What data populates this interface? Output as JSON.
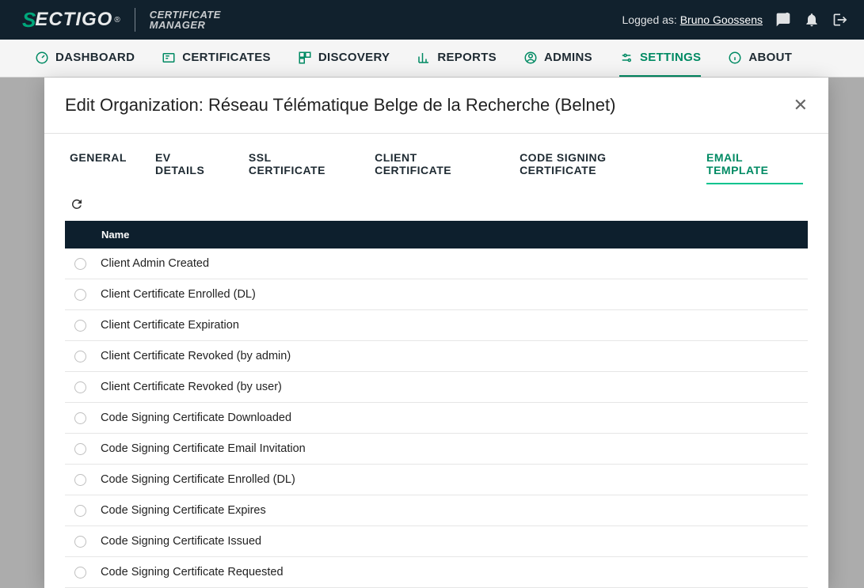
{
  "header": {
    "logo_s": "S",
    "logo_rest": "ECTIGO",
    "logo_reg": "®",
    "logo_sub_line1": "CERTIFICATE",
    "logo_sub_line2": "MANAGER",
    "logged_label": "Logged as:",
    "logged_user": "Bruno Goossens"
  },
  "nav": [
    {
      "label": "DASHBOARD"
    },
    {
      "label": "CERTIFICATES"
    },
    {
      "label": "DISCOVERY"
    },
    {
      "label": "REPORTS"
    },
    {
      "label": "ADMINS"
    },
    {
      "label": "SETTINGS"
    },
    {
      "label": "ABOUT"
    }
  ],
  "modal": {
    "title": "Edit Organization: Réseau Télématique Belge de la Recherche (Belnet)",
    "tabs": [
      {
        "label": "GENERAL"
      },
      {
        "label": "EV DETAILS"
      },
      {
        "label": "SSL CERTIFICATE"
      },
      {
        "label": "CLIENT CERTIFICATE"
      },
      {
        "label": "CODE SIGNING CERTIFICATE"
      },
      {
        "label": "EMAIL TEMPLATE"
      }
    ],
    "active_tab_index": 5,
    "column_header": "Name",
    "templates": [
      "Client Admin Created",
      "Client Certificate Enrolled (DL)",
      "Client Certificate Expiration",
      "Client Certificate Revoked (by admin)",
      "Client Certificate Revoked (by user)",
      "Code Signing Certificate Downloaded",
      "Code Signing Certificate Email Invitation",
      "Code Signing Certificate Enrolled (DL)",
      "Code Signing Certificate Expires",
      "Code Signing Certificate Issued",
      "Code Signing Certificate Requested"
    ]
  }
}
